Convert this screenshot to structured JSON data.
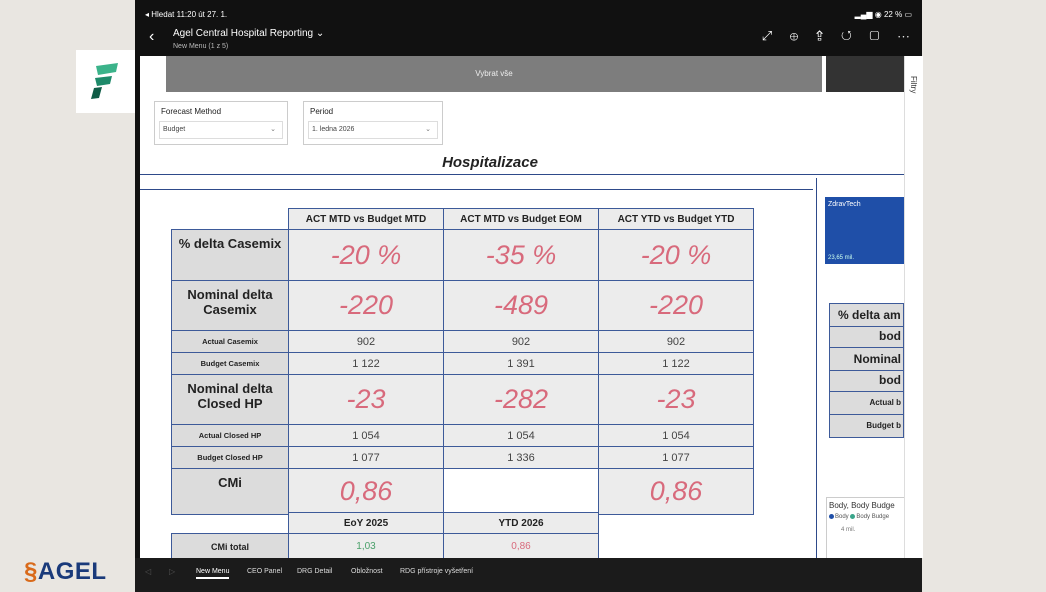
{
  "status": {
    "left": "◂ Hledat  11:20  út 27. 1.",
    "right": "22 %"
  },
  "app": {
    "title": "Agel Central Hospital Reporting",
    "subtitle": "New Menu (1 z 5)"
  },
  "brand": {
    "agel": "AGEL"
  },
  "filter_pane": {
    "label": "Filtry"
  },
  "select_all": "Vybrat vše",
  "slicers": {
    "forecast": {
      "label": "Forecast Method",
      "value": "Budget"
    },
    "period": {
      "label": "Period",
      "value": "1. ledna 2026"
    }
  },
  "page_title": "Hospitalizace",
  "kpi": {
    "headers": [
      "ACT MTD vs Budget MTD",
      "ACT MTD vs Budget EOM",
      "ACT YTD vs Budget YTD"
    ],
    "rows": [
      {
        "label": "% delta Casemix",
        "values": [
          "-20 %",
          "-35 %",
          "-20 %"
        ]
      },
      {
        "label": "Nominal delta Casemix",
        "values": [
          "-220",
          "-489",
          "-220"
        ]
      },
      {
        "label": "Actual Casemix",
        "values": [
          "902",
          "902",
          "902"
        ]
      },
      {
        "label": "Budget Casemix",
        "values": [
          "1 122",
          "1 391",
          "1 122"
        ]
      },
      {
        "label": "Nominal delta Closed HP",
        "values": [
          "-23",
          "-282",
          "-23"
        ]
      },
      {
        "label": "Actual Closed HP",
        "values": [
          "1 054",
          "1 054",
          "1 054"
        ]
      },
      {
        "label": "Budget Closed HP",
        "values": [
          "1 077",
          "1 336",
          "1 077"
        ]
      },
      {
        "label": "CMi",
        "values": [
          "0,86",
          "",
          "0,86"
        ]
      }
    ]
  },
  "cmi_total": {
    "headers": [
      "EoY 2025",
      "YTD 2026"
    ],
    "label": "CMi total",
    "values": [
      "1,03",
      "0,86"
    ]
  },
  "side_tile": {
    "name": "ZdravTech",
    "value": "23,65 mil."
  },
  "side_table": [
    "% delta am",
    "bod",
    "Nominal",
    "bod",
    "Actual b",
    "Budget b"
  ],
  "side_chart": {
    "title": "Body, Body Budge",
    "legend": [
      "Body",
      "Body Budge"
    ],
    "tick": "4 mil.",
    "colors": [
      "#1f4fa8",
      "#3aa58a"
    ]
  },
  "tabs": [
    "New Menu",
    "CEO Panel",
    "DRG Detail",
    "Obložnost",
    "RDG přístroje vyšetření"
  ]
}
